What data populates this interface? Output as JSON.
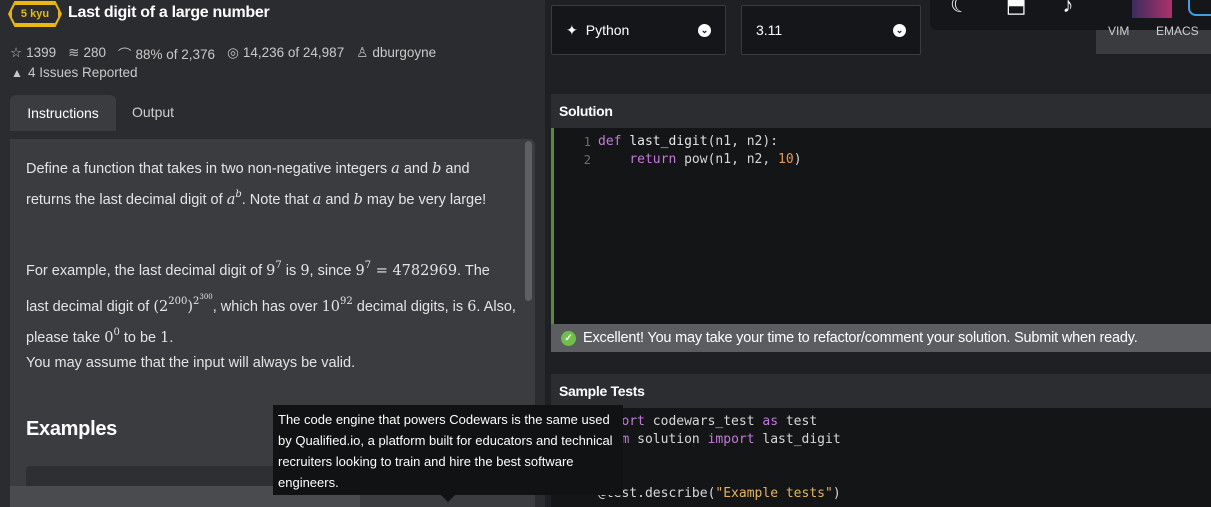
{
  "kata": {
    "rank": "5 kyu",
    "title": "Last digit of a large number",
    "stars": "1399",
    "collections": "280",
    "satisfaction": "88% of 2,376",
    "completions": "14,236 of 24,987",
    "author": "dburgoyne",
    "issues": "4 Issues Reported"
  },
  "tabs": {
    "instructions": "Instructions",
    "output": "Output"
  },
  "instructions": {
    "examples_heading": "Examples"
  },
  "tooltip": {
    "text": "The code engine that powers Codewars is the same used by Qualified.io, a platform built for educators and technical recruiters looking to train and hire the best software engineers."
  },
  "editor": {
    "language": "Python",
    "version": "3.11",
    "mode_labels": [
      "VIM",
      "EMACS"
    ],
    "solution_heading": "Solution",
    "line_numbers": [
      "1",
      "2"
    ],
    "success_message": "Excellent! You may take your time to refactor/comment your solution. Submit when ready.",
    "sample_tests_heading": "Sample Tests"
  },
  "colors": {
    "rank": "#ecb613",
    "success": "#6fbf4a",
    "accent_border": "#5a8a3a"
  },
  "icons": [
    "star-icon",
    "collection-icon",
    "eye-icon",
    "target-icon",
    "user-icon",
    "warning-icon",
    "python-icon",
    "chevron-down-icon",
    "moon-icon",
    "bookmark-icon",
    "bell-icon",
    "check-circle-icon"
  ]
}
